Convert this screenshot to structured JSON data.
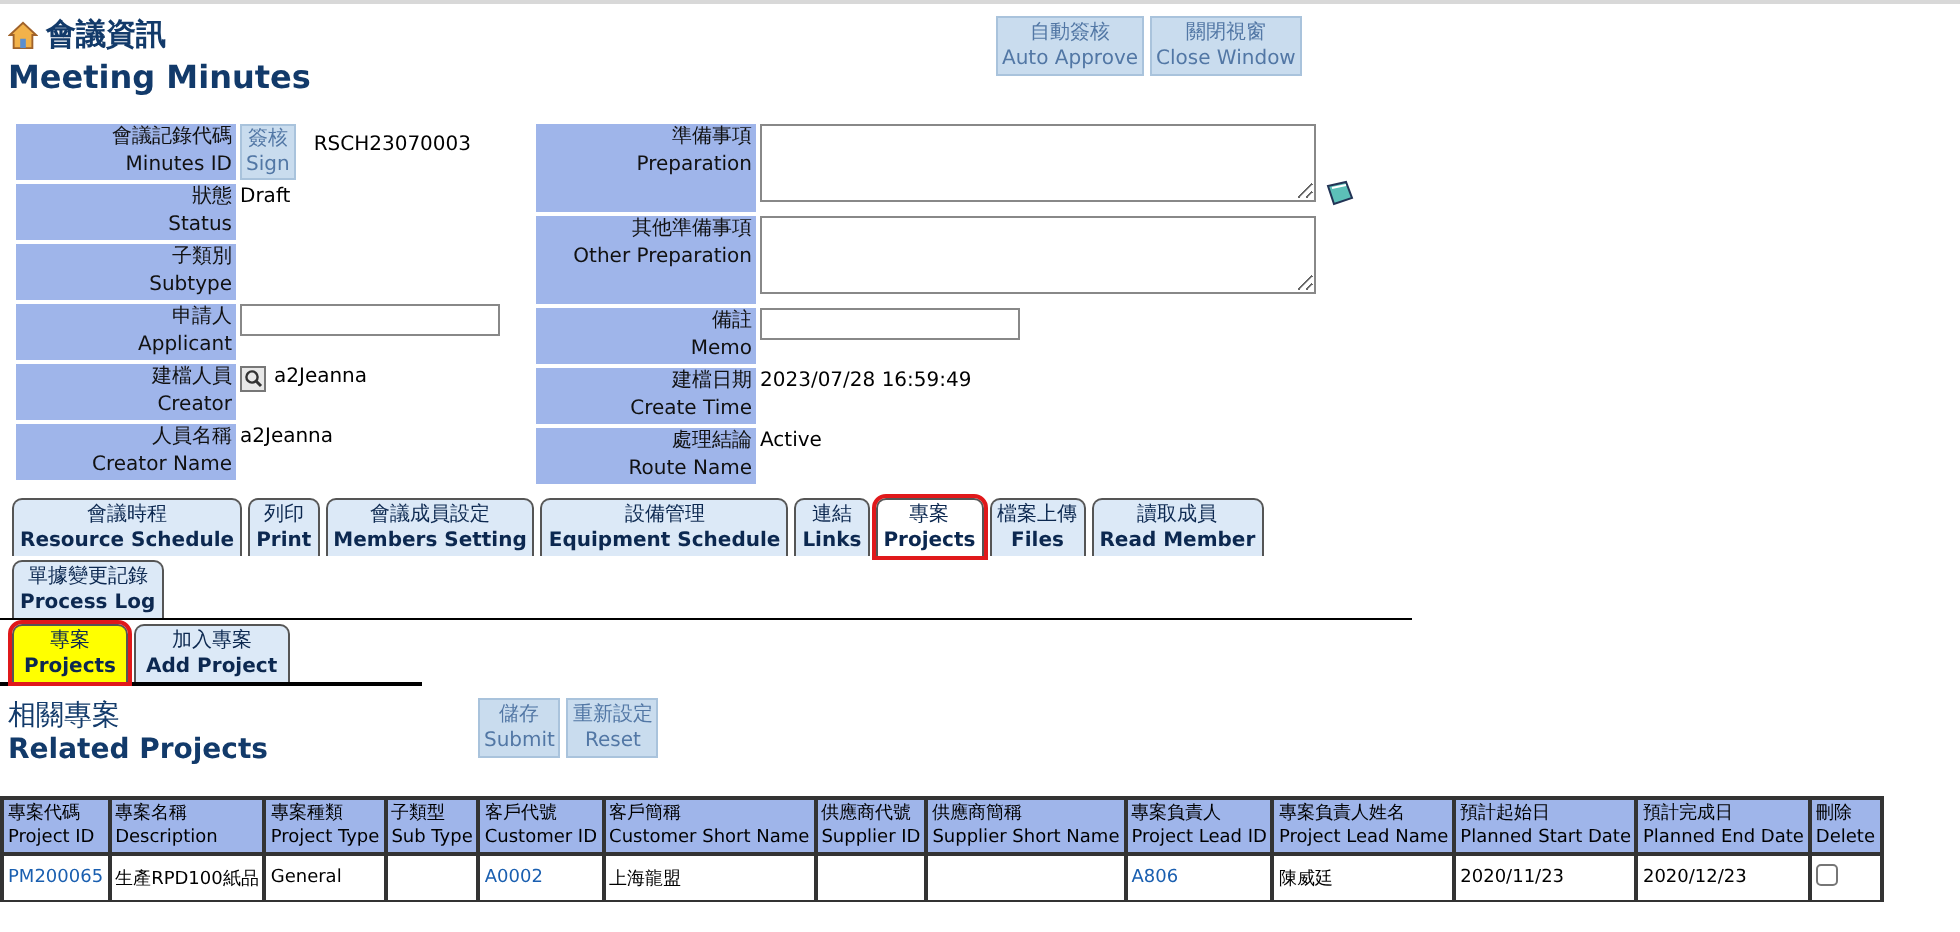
{
  "header": {
    "title_zh": "會議資訊",
    "title_en": "Meeting Minutes"
  },
  "top_buttons": [
    {
      "zh": "自動簽核",
      "en": "Auto Approve"
    },
    {
      "zh": "關閉視窗",
      "en": "Close Window"
    }
  ],
  "left_fields": [
    {
      "zh": "會議記錄代碼",
      "en": "Minutes ID",
      "kind": "sign",
      "value": "RSCH23070003",
      "button_zh": "簽核",
      "button_en": "Sign"
    },
    {
      "zh": "狀態",
      "en": "Status",
      "kind": "text",
      "value": "Draft"
    },
    {
      "zh": "子類別",
      "en": "Subtype",
      "kind": "empty"
    },
    {
      "zh": "申請人",
      "en": "Applicant",
      "kind": "input"
    },
    {
      "zh": "建檔人員",
      "en": "Creator",
      "kind": "lookup",
      "value": "a2Jeanna"
    },
    {
      "zh": "人員名稱",
      "en": "Creator Name",
      "kind": "text",
      "value": "a2Jeanna"
    }
  ],
  "right_fields": [
    {
      "zh": "準備事項",
      "en": "Preparation",
      "kind": "textarea",
      "attach": true
    },
    {
      "zh": "其他準備事項",
      "en": "Other Preparation",
      "kind": "textarea",
      "attach": false
    },
    {
      "zh": "備註",
      "en": "Memo",
      "kind": "input"
    },
    {
      "zh": "建檔日期",
      "en": "Create Time",
      "kind": "text",
      "value": "2023/07/28 16:59:49"
    },
    {
      "zh": "處理結論",
      "en": "Route Name",
      "kind": "text",
      "value": "Active"
    }
  ],
  "tabs": [
    {
      "zh": "會議時程",
      "en": "Resource Schedule",
      "selected": false,
      "outlined": false
    },
    {
      "zh": "列印",
      "en": "Print",
      "selected": false,
      "outlined": false
    },
    {
      "zh": "會議成員設定",
      "en": "Members Setting",
      "selected": false,
      "outlined": false
    },
    {
      "zh": "設備管理",
      "en": "Equipment Schedule",
      "selected": false,
      "outlined": false
    },
    {
      "zh": "連結",
      "en": "Links",
      "selected": false,
      "outlined": false
    },
    {
      "zh": "專案",
      "en": "Projects",
      "selected": true,
      "outlined": true
    },
    {
      "zh": "檔案上傳",
      "en": "Files",
      "selected": false,
      "outlined": false
    },
    {
      "zh": "讀取成員",
      "en": "Read Member",
      "selected": false,
      "outlined": false
    },
    {
      "zh": "單據變更記錄",
      "en": "Process Log",
      "selected": false,
      "outlined": false
    }
  ],
  "sub_tabs": [
    {
      "zh": "專案",
      "en": "Projects",
      "selected": true,
      "outlined": true
    },
    {
      "zh": "加入專案",
      "en": "Add Project",
      "selected": false,
      "outlined": false
    }
  ],
  "section": {
    "title_zh": "相關專案",
    "title_en": "Related Projects"
  },
  "section_buttons": [
    {
      "zh": "儲存",
      "en": "Submit"
    },
    {
      "zh": "重新設定",
      "en": "Reset"
    }
  ],
  "table": {
    "columns": [
      {
        "zh": "專案代碼",
        "en": "Project ID"
      },
      {
        "zh": "專案名稱",
        "en": "Description"
      },
      {
        "zh": "專案種類",
        "en": "Project Type"
      },
      {
        "zh": "子類型",
        "en": "Sub Type"
      },
      {
        "zh": "客戶代號",
        "en": "Customer ID"
      },
      {
        "zh": "客戶簡稱",
        "en": "Customer Short Name"
      },
      {
        "zh": "供應商代號",
        "en": "Supplier ID"
      },
      {
        "zh": "供應商簡稱",
        "en": "Supplier Short Name"
      },
      {
        "zh": "專案負責人",
        "en": "Project Lead ID"
      },
      {
        "zh": "專案負責人姓名",
        "en": "Project Lead Name"
      },
      {
        "zh": "預計起始日",
        "en": "Planned Start Date"
      },
      {
        "zh": "預計完成日",
        "en": "Planned End Date"
      },
      {
        "zh": "刪除",
        "en": "Delete"
      }
    ],
    "rows": [
      {
        "cells": [
          {
            "kind": "link",
            "text": "PM200065"
          },
          {
            "kind": "text",
            "text": "生產RPD100紙品"
          },
          {
            "kind": "text",
            "text": "General"
          },
          {
            "kind": "empty"
          },
          {
            "kind": "link",
            "text": "A0002"
          },
          {
            "kind": "text",
            "text": "上海龍盟"
          },
          {
            "kind": "empty"
          },
          {
            "kind": "empty"
          },
          {
            "kind": "link",
            "text": "A806"
          },
          {
            "kind": "text",
            "text": "陳威廷"
          },
          {
            "kind": "text",
            "text": "2020/11/23"
          },
          {
            "kind": "text",
            "text": "2020/12/23"
          },
          {
            "kind": "checkbox",
            "checked": false
          }
        ]
      }
    ]
  }
}
